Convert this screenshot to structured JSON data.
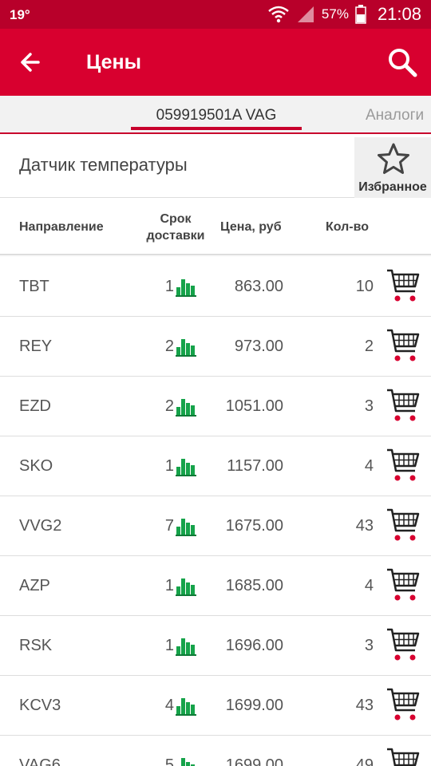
{
  "status_bar": {
    "temperature": "19°",
    "battery": "57%",
    "time": "21:08"
  },
  "app_bar": {
    "title": "Цены"
  },
  "tabs": {
    "active": "059919501A VAG",
    "other": "Аналоги"
  },
  "product": {
    "name": "Датчик температуры",
    "favorite_label": "Избранное"
  },
  "table": {
    "headers": {
      "direction": "Направление",
      "delivery_line1": "Срок",
      "delivery_line2": "доставки",
      "price": "Цена, руб",
      "qty": "Кол-во"
    },
    "rows": [
      {
        "direction": "TBT",
        "days": "1",
        "price": "863.00",
        "qty": "10"
      },
      {
        "direction": "REY",
        "days": "2",
        "price": "973.00",
        "qty": "2"
      },
      {
        "direction": "EZD",
        "days": "2",
        "price": "1051.00",
        "qty": "3"
      },
      {
        "direction": "SKO",
        "days": "1",
        "price": "1157.00",
        "qty": "4"
      },
      {
        "direction": "VVG2",
        "days": "7",
        "price": "1675.00",
        "qty": "43"
      },
      {
        "direction": "AZP",
        "days": "1",
        "price": "1685.00",
        "qty": "4"
      },
      {
        "direction": "RSK",
        "days": "1",
        "price": "1696.00",
        "qty": "3"
      },
      {
        "direction": "KCV3",
        "days": "4",
        "price": "1699.00",
        "qty": "43"
      },
      {
        "direction": "VAG6",
        "days": "5",
        "price": "1699.00",
        "qty": "49"
      }
    ]
  },
  "colors": {
    "primary": "#d8002f",
    "status_bar": "#b8002a",
    "accent": "#c8002c",
    "stats_icon": "#16a34a",
    "cart_wheels": "#d8002f"
  },
  "icons": {
    "back": "arrow-left-icon",
    "search": "search-icon",
    "favorite": "star-outline-icon",
    "stats": "bar-chart-icon",
    "cart": "shopping-cart-icon"
  }
}
